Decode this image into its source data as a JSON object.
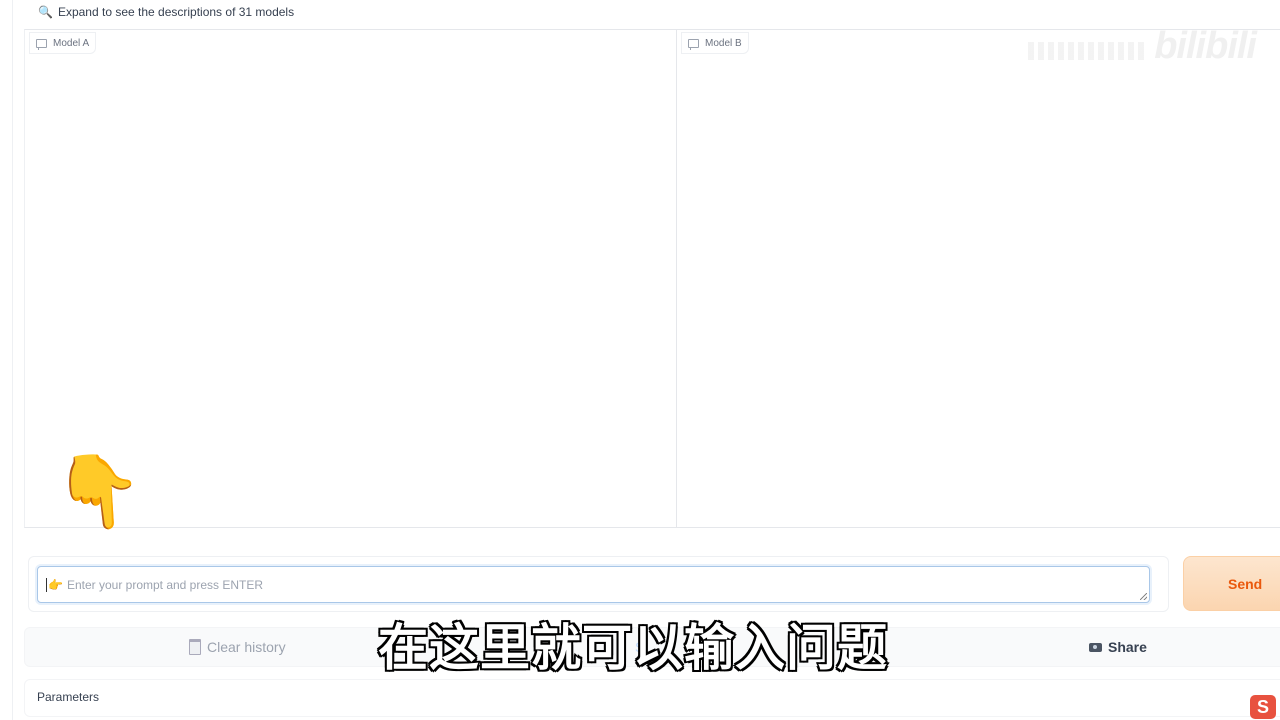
{
  "expand_notice": {
    "icon": "magnifier-icon",
    "text": "Expand to see the descriptions of 31 models"
  },
  "panels": [
    {
      "label": "Model A",
      "icon": "chat-bubble-icon"
    },
    {
      "label": "Model B",
      "icon": "chat-bubble-icon"
    }
  ],
  "watermark": {
    "text": "bilibili"
  },
  "prompt": {
    "value": "",
    "hand_glyph": "👉",
    "placeholder": "Enter your prompt and press ENTER"
  },
  "send_button": {
    "label": "Send"
  },
  "actions": {
    "clear_label": "Clear history",
    "share_label": "Share",
    "partial_label": "S"
  },
  "parameters": {
    "label": "Parameters"
  },
  "overlay": {
    "pointer_glyph": "👇",
    "caption": "在这里就可以输入问题",
    "corner_logo": "S"
  },
  "colors": {
    "accent": "#ea580c",
    "send_bg": "#fbd5b0",
    "focus_border": "#a9c7e8"
  }
}
